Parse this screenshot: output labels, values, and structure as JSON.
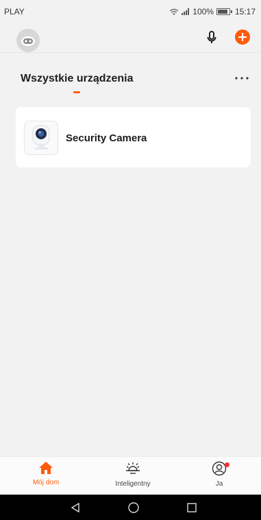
{
  "status_bar": {
    "carrier": "PLAY",
    "battery_percent": "100%",
    "time": "15:17"
  },
  "header": {
    "section_title": "Wszystkie urządzenia"
  },
  "devices": [
    {
      "name": "Security Camera",
      "icon": "camera-icon"
    }
  ],
  "bottom_nav": {
    "items": [
      {
        "label": "Mój dom",
        "icon": "home-icon",
        "active": true
      },
      {
        "label": "Inteligentny",
        "icon": "sun-icon",
        "active": false
      },
      {
        "label": "Ja",
        "icon": "user-icon",
        "active": false,
        "badge": true
      }
    ]
  },
  "colors": {
    "accent": "#ff5a0a",
    "background": "#f2f2f2",
    "card": "#ffffff",
    "system_nav": "#000000"
  }
}
